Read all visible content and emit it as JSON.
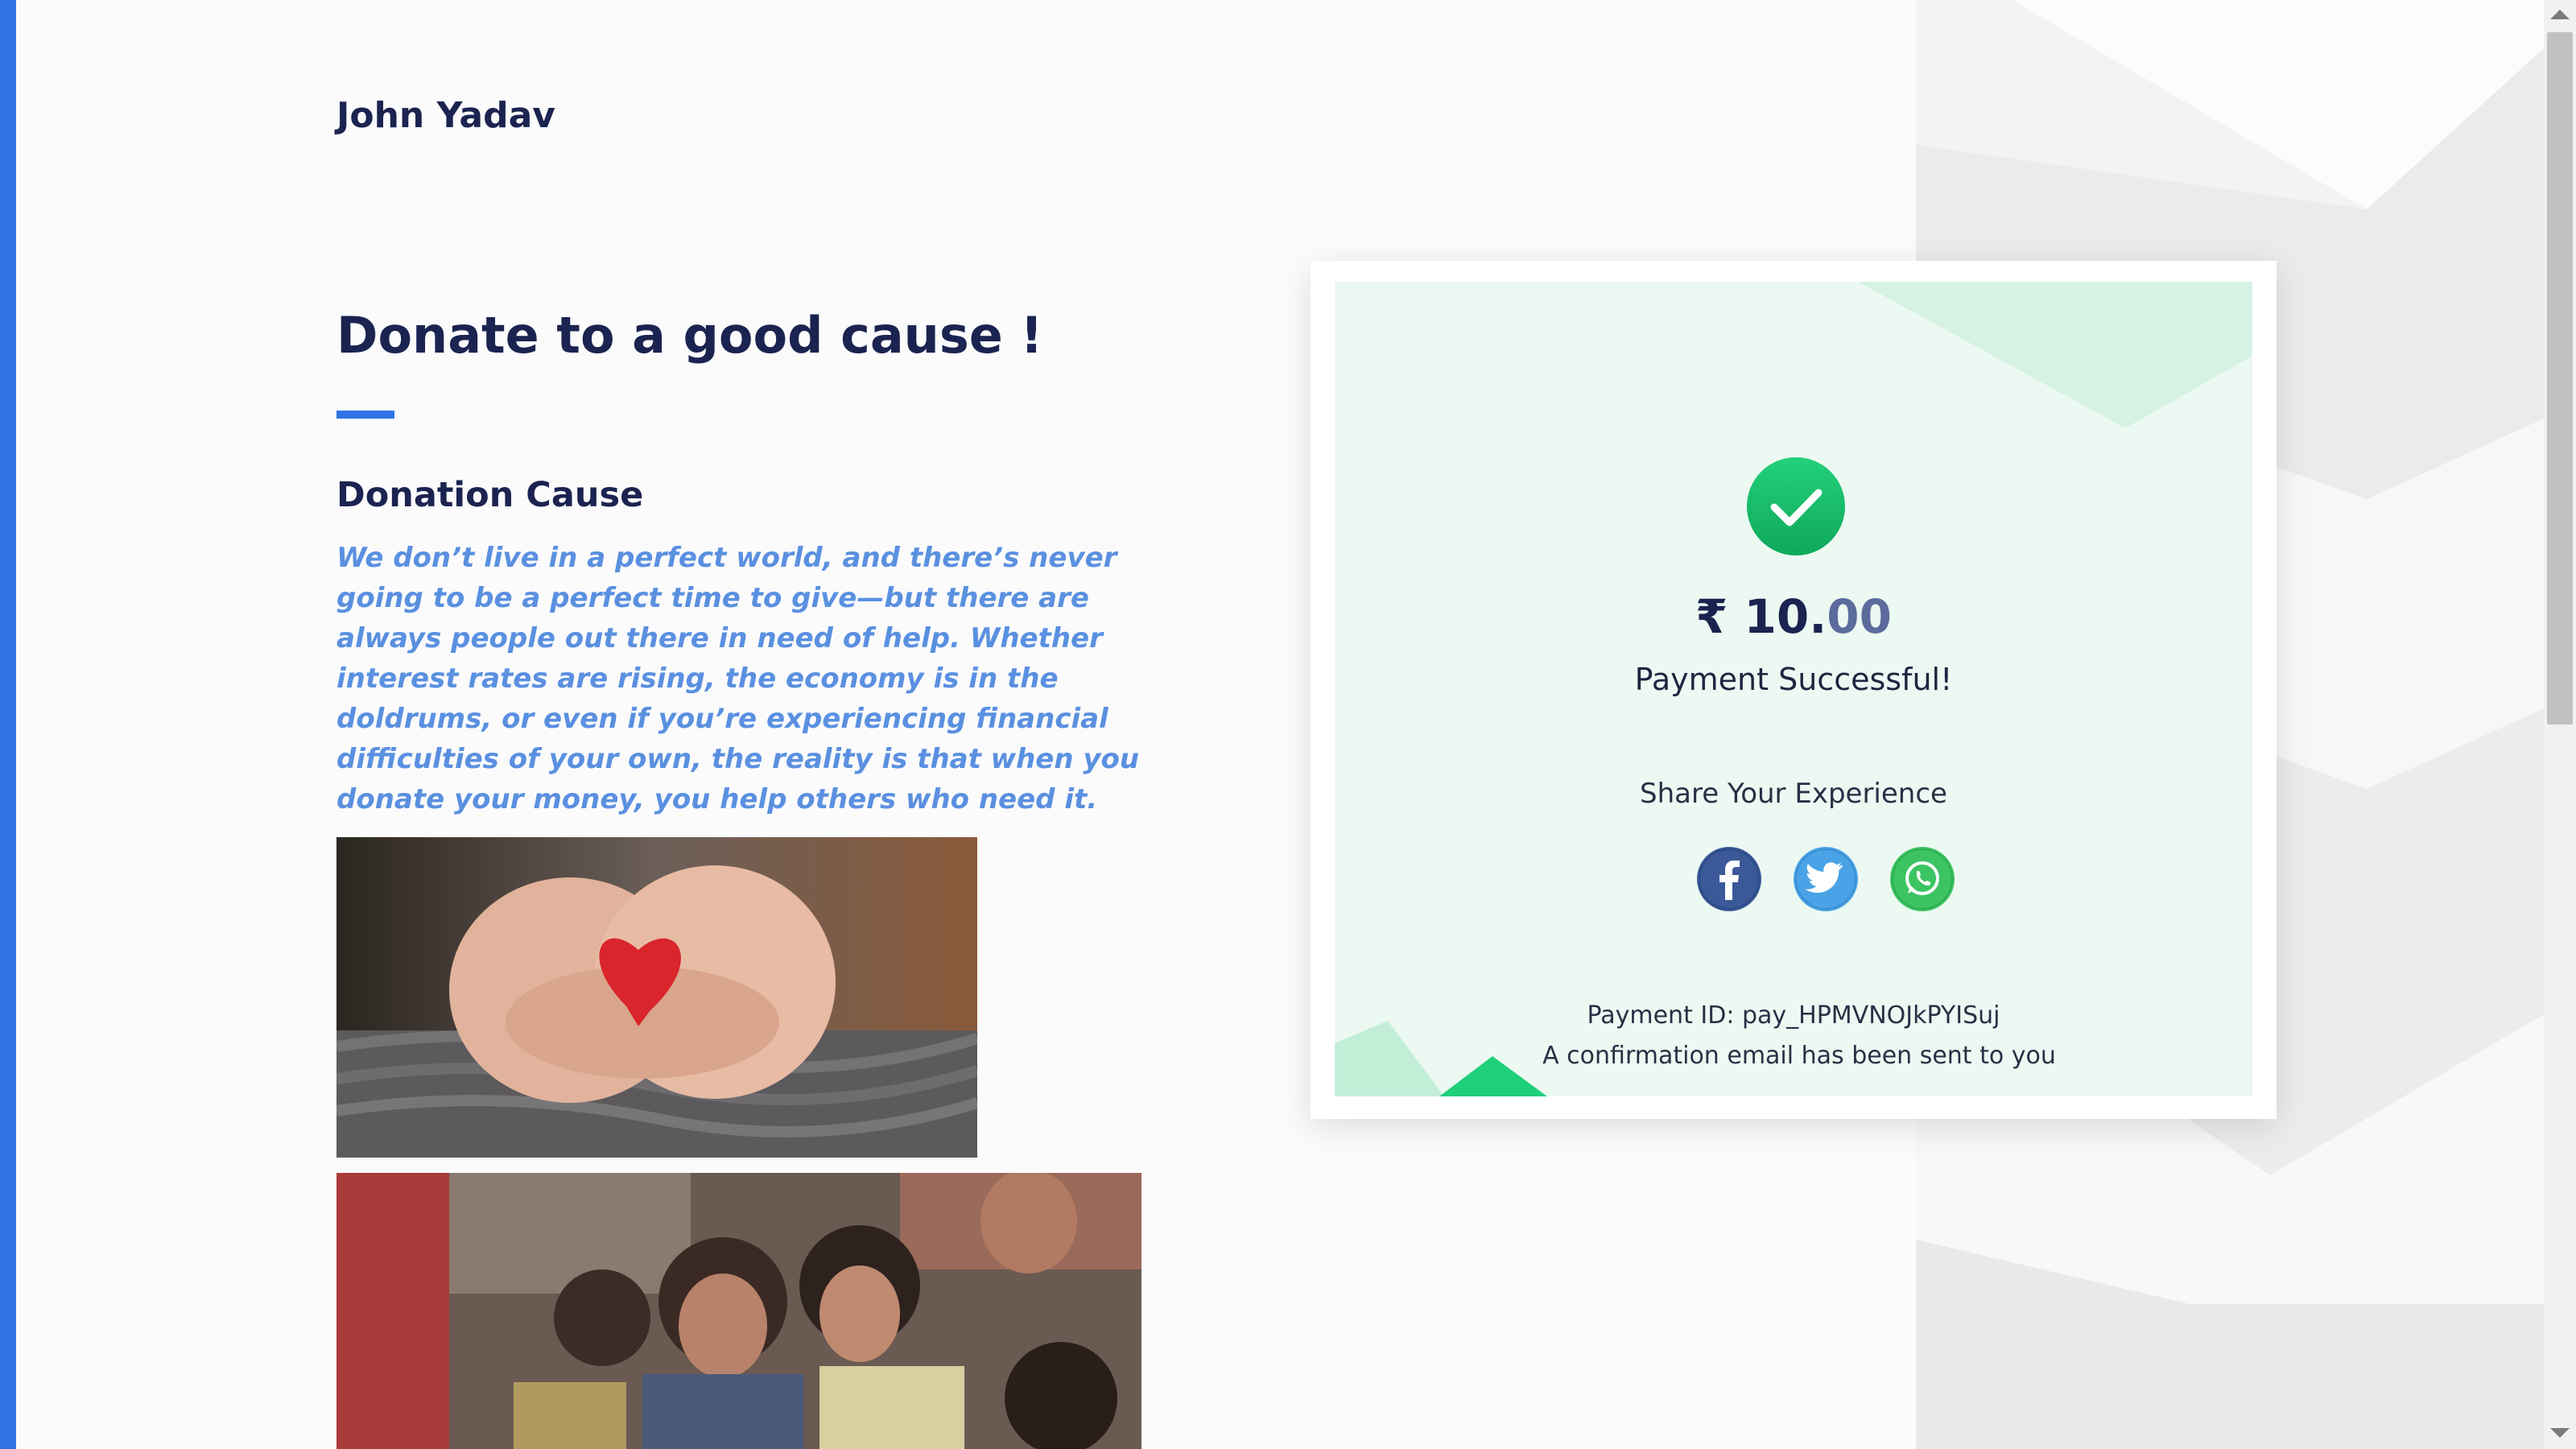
{
  "header": {
    "merchant_name": "John Yadav"
  },
  "main": {
    "title": "Donate to a good cause !",
    "cause_heading": "Donation Cause",
    "cause_description": "We don’t live in a perfect world, and there’s never going to be a perfect time to give—but there are always people out there in need of help. Whether interest rates are rising, the economy is in the doldrums, or even if you’re experiencing financial difficulties of your own, the reality is that when you donate your money, you help others who need it."
  },
  "payment_card": {
    "currency_symbol": "₹",
    "amount_whole": "10.",
    "amount_decimal": "00",
    "status": "Payment Successful!",
    "share_label": "Share Your Experience",
    "social_icons": [
      "facebook-icon",
      "twitter-icon",
      "whatsapp-icon"
    ],
    "payment_id_text": "Payment ID: pay_HPMVNOJkPYISuj",
    "confirmation_text": "A confirmation email has been sent to you"
  },
  "colors": {
    "accent": "#2f73e6",
    "success": "#1fbf6a",
    "card_background": "#ecf9f2",
    "heading": "#1b2350",
    "cause_text": "#5a90e0"
  }
}
